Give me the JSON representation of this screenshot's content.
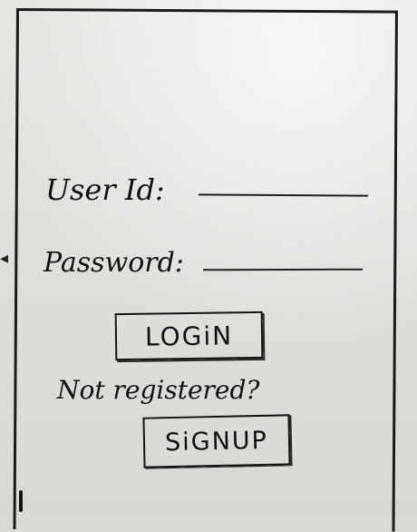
{
  "sketch": {
    "background_color": "#d9dad5",
    "ink_color": "#151515"
  },
  "form": {
    "userid_label": "User Id:",
    "password_label": "Password:",
    "login_button": "LOGiN",
    "signup_prompt": "Not registered?",
    "signup_button": "SiGNUP"
  }
}
